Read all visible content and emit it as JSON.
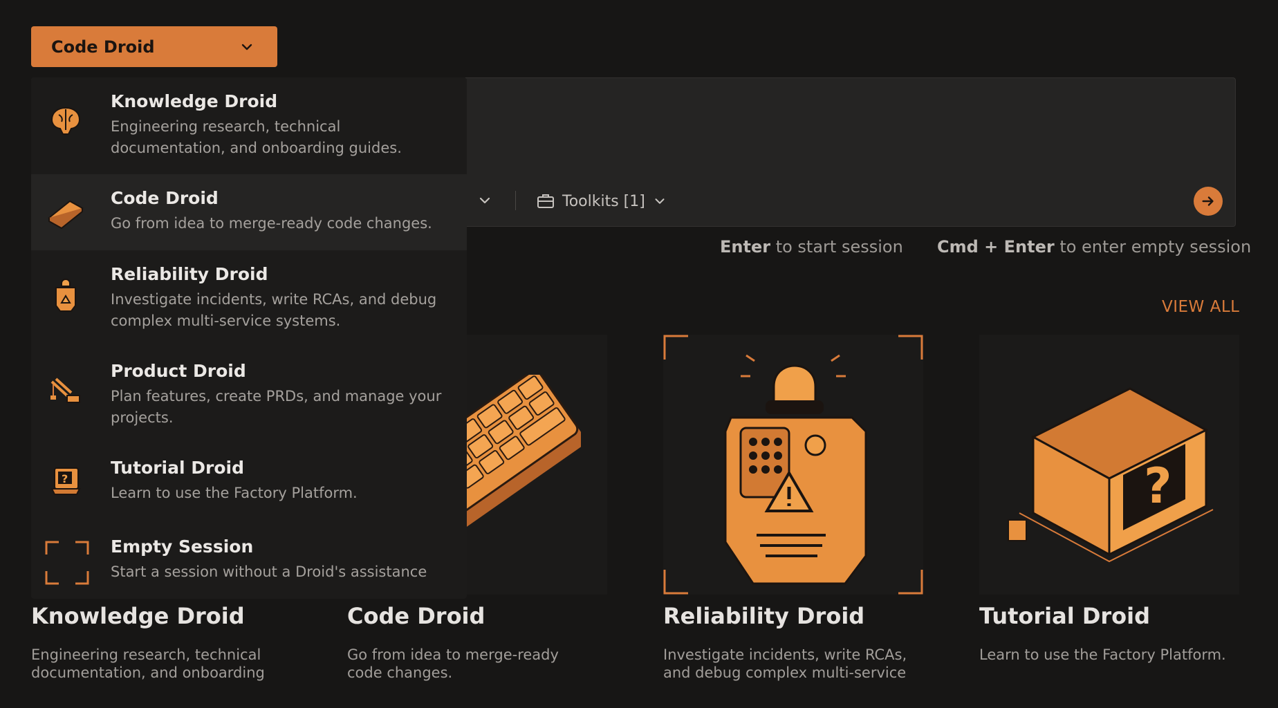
{
  "selector": {
    "label": "Code Droid"
  },
  "toolbar": {
    "toolkits_label": "Toolkits [1]"
  },
  "hints": {
    "enter_key": "Enter",
    "enter_text": " to start session",
    "cmd_key": "Cmd + Enter",
    "cmd_text": " to enter empty session"
  },
  "gallery": {
    "view_all": "VIEW ALL",
    "cards": [
      {
        "title": "Knowledge Droid",
        "desc": "Engineering research, technical documentation, and onboarding"
      },
      {
        "title": "Code Droid",
        "desc": "Go from idea to merge-ready code changes."
      },
      {
        "title": "Reliability Droid",
        "desc": "Investigate incidents, write RCAs, and debug complex multi-service"
      },
      {
        "title": "Tutorial Droid",
        "desc": "Learn to use the Factory Platform."
      }
    ]
  },
  "menu": {
    "items": [
      {
        "title": "Knowledge Droid",
        "desc": "Engineering research, technical documentation, and onboarding guides.",
        "icon": "brain-icon"
      },
      {
        "title": "Code Droid",
        "desc": "Go from idea to merge-ready code changes.",
        "icon": "keyboard-icon",
        "selected": true
      },
      {
        "title": "Reliability Droid",
        "desc": "Investigate incidents, write RCAs, and debug complex multi-service systems.",
        "icon": "alarm-robot-icon"
      },
      {
        "title": "Product Droid",
        "desc": "Plan features, create PRDs, and manage your projects.",
        "icon": "crane-icon"
      },
      {
        "title": "Tutorial Droid",
        "desc": "Learn to use the Factory Platform.",
        "icon": "computer-icon"
      },
      {
        "title": "Empty Session",
        "desc": "Start a session without a Droid's assistance",
        "icon": "empty-frame-icon"
      }
    ]
  },
  "colors": {
    "accent": "#d97b3a",
    "background": "#171615",
    "panel": "#252423"
  }
}
